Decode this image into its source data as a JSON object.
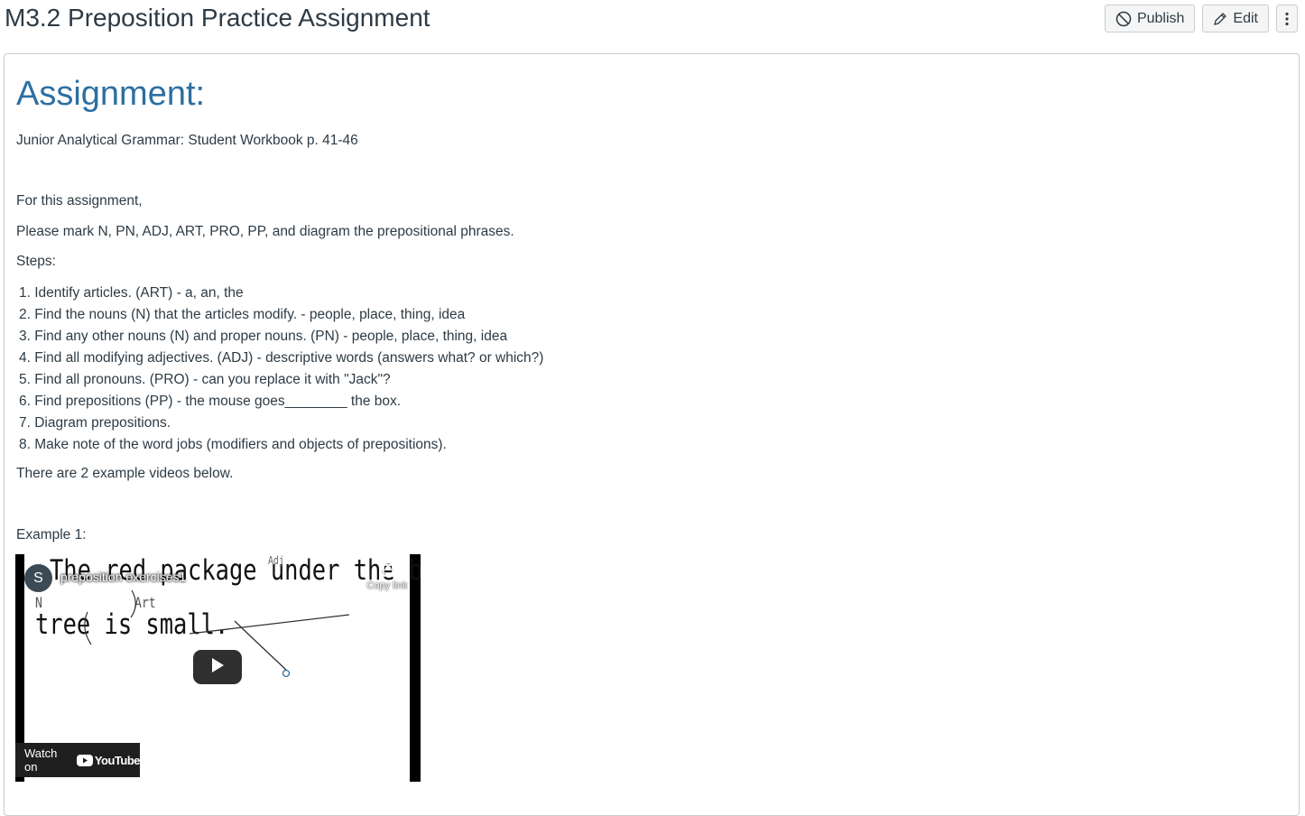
{
  "page": {
    "title": "M3.2 Preposition Practice Assignment"
  },
  "toolbar": {
    "publish_label": "Publish",
    "edit_label": "Edit"
  },
  "content": {
    "heading": "Assignment:",
    "book": "Junior Analytical Grammar: Student Workbook p. 41-46",
    "intro": "For this assignment,",
    "instruction": "Please mark N, PN, ADJ, ART, PRO, PP, and diagram the prepositional phrases.",
    "steps_label": "Steps:",
    "steps": [
      "1. Identify articles. (ART) - a, an, the",
      "2. Find the nouns (N) that the articles modify. - people, place, thing, idea",
      "3. Find any other nouns (N) and proper nouns. (PN) - people, place, thing, idea",
      "4. Find all modifying adjectives. (ADJ) - descriptive words (answers what? or which?)",
      "5. Find all pronouns. (PRO) - can you replace it with \"Jack\"?",
      "6. Find prepositions (PP) - the mouse goes________ the box.",
      "7. Diagram prepositions.",
      "8. Make note of the word jobs (modifiers and objects of prepositions)."
    ],
    "videos_note": "There are 2 example videos below.",
    "example_label": "Example 1:"
  },
  "video": {
    "channel_initial": "S",
    "title": "preposition exercises1",
    "copy_link": "Copy link",
    "watch_on": "Watch on",
    "youtube": "YouTube",
    "whiteboard_line1": "The red package under the beautiful",
    "whiteboard_line2": "tree is small.",
    "annotation_n": "N",
    "annotation_art": "Art",
    "annotation_adj": "Adj"
  }
}
